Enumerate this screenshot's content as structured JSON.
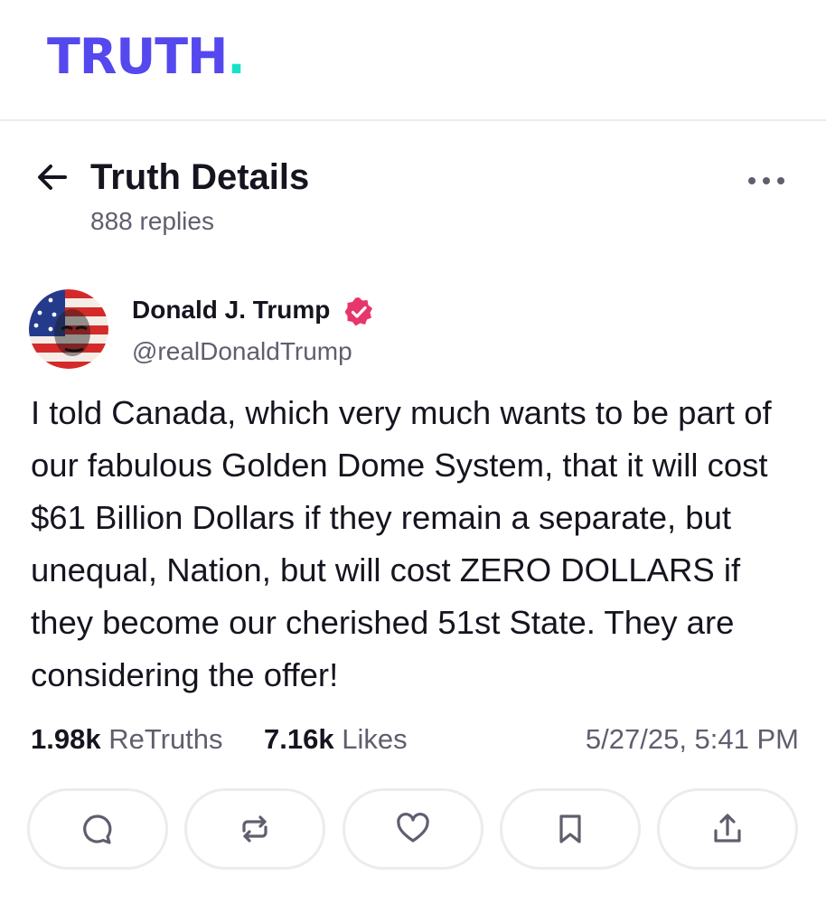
{
  "brand": {
    "logo_text": "TRUTH",
    "logo_dot": ".",
    "primary_color": "#5448ee",
    "accent_color": "#17e2c7"
  },
  "header": {
    "title": "Truth Details",
    "replies": "888 replies"
  },
  "post": {
    "author_name": "Donald J. Trump",
    "verified": true,
    "handle": "@realDonaldTrump",
    "text": "I told Canada, which very much wants to be part of our fabulous Golden Dome System, that it will cost $61 Billion Dollars if they remain a separate, but unequal, Nation, but will cost ZERO DOLLARS if they become our cherished 51st State. They are considering the offer!",
    "retruths_count": "1.98k",
    "retruths_label": "ReTruths",
    "likes_count": "7.16k",
    "likes_label": "Likes",
    "timestamp": "5/27/25, 5:41 PM"
  },
  "actions": [
    "reply-icon",
    "retruth-icon",
    "heart-icon",
    "bookmark-icon",
    "share-icon"
  ]
}
